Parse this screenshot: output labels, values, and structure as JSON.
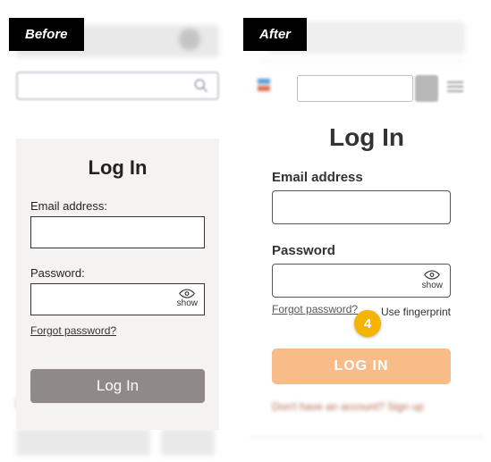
{
  "badges": {
    "before": "Before",
    "after": "After"
  },
  "before": {
    "title": "Log In",
    "email_label": "Email address:",
    "password_label": "Password:",
    "show_text": "show",
    "forgot": "Forgot password?",
    "button": "Log In"
  },
  "after": {
    "title": "Log In",
    "email_label": "Email address",
    "password_label": "Password",
    "show_text": "show",
    "forgot": "Forgot password?",
    "fingerprint": "Use fingerprint",
    "button": "LOG IN",
    "marker": "4"
  }
}
